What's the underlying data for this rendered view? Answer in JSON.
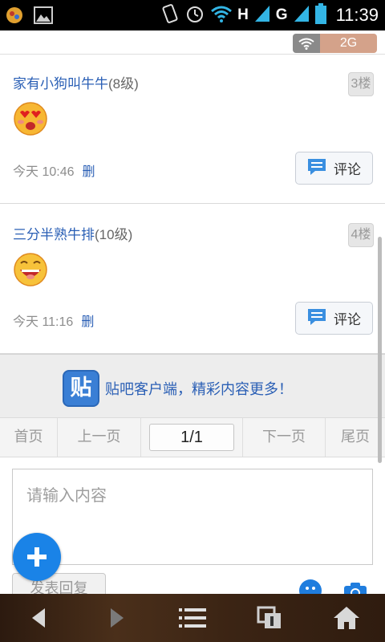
{
  "status_bar": {
    "time": "11:39",
    "net_label_1": "H",
    "net_label_2": "G"
  },
  "network_banner": {
    "network_type": "2G"
  },
  "posts": [
    {
      "username": "家有小狗叫牛牛",
      "level": "(8级)",
      "floor": "3楼",
      "emoji": "heart-eyes-face",
      "time": "今天 10:46",
      "delete_label": "删",
      "comment_label": "评论"
    },
    {
      "username": "三分半熟牛排",
      "level": "(10级)",
      "floor": "4楼",
      "emoji": "laughing-face",
      "time": "今天 11:16",
      "delete_label": "删",
      "comment_label": "评论"
    }
  ],
  "promo": {
    "logo_char": "贴",
    "text": "贴吧客户端，精彩内容更多！"
  },
  "pager": {
    "first": "首页",
    "prev": "上一页",
    "current": "1/1",
    "next": "下一页",
    "last": "尾页"
  },
  "reply": {
    "placeholder": "请输入内容",
    "submit_label": "发表回复"
  },
  "colors": {
    "link_blue": "#2a5fb5",
    "fab_blue": "#1a83e7",
    "badge_2g": "#d4a28a"
  },
  "icons": [
    "menu-icon",
    "image-icon",
    "vibrate-icon",
    "alarm-icon",
    "wifi-icon",
    "signal-icon",
    "battery-icon",
    "comment-icon",
    "plus-icon",
    "smile-icon",
    "camera-icon",
    "back-icon",
    "forward-icon",
    "list-icon",
    "tabs-icon",
    "home-icon"
  ]
}
